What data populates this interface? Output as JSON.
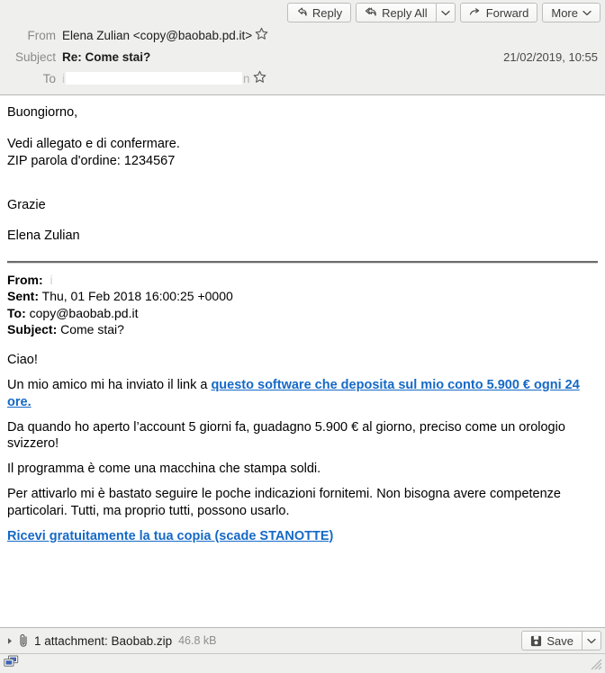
{
  "toolbar": {
    "reply_label": "Reply",
    "reply_all_label": "Reply All",
    "forward_label": "Forward",
    "more_label": "More"
  },
  "headers": {
    "from_label": "From",
    "from_value": "Elena Zulian <copy@baobab.pd.it>",
    "subject_label": "Subject",
    "subject_value": "Re: Come stai?",
    "to_label": "To",
    "to_value_prefix": "i",
    "to_value_suffix": "n",
    "date": "21/02/2019, 10:55"
  },
  "body": {
    "greeting": "Buongiorno,",
    "line_attachment": "Vedi allegato e di confermare.",
    "line_password": "ZIP parola d'ordine: 1234567",
    "thanks": "Grazie",
    "signature": "Elena Zulian"
  },
  "quoted_header": {
    "from_label": "From:",
    "from_value": "",
    "sent_label": "Sent:",
    "sent_value": "Thu, 01 Feb 2018 16:00:25 +0000",
    "to_label": "To:",
    "to_value": "copy@baobab.pd.it",
    "subject_label": "Subject:",
    "subject_value": "Come stai?"
  },
  "quoted_body": {
    "greeting": "Ciao!",
    "para1_prefix": "Un mio amico mi ha inviato il link a ",
    "para1_link": "questo software che deposita sul mio conto 5.900 € ogni 24 ore.",
    "para2": "Da quando ho aperto l’account 5 giorni fa, guadagno 5.900 € al giorno, preciso come un orologio svizzero!",
    "para3": "Il programma è come una macchina che stampa soldi.",
    "para4": "Per attivarlo mi è bastato seguire le poche indicazioni fornitemi. Non bisogna avere competenze particolari. Tutti, ma proprio tutti, possono usarlo.",
    "cta_link": "Ricevi gratuitamente la tua copia (scade STANOTTE)"
  },
  "attachment": {
    "label": "1 attachment: Baobab.zip",
    "size": "46.8 kB",
    "save_label": "Save"
  },
  "colors": {
    "link": "#1569c7",
    "chrome": "#efefee",
    "label_gray": "#8a8a87",
    "size_gray": "#8d8d8a"
  }
}
